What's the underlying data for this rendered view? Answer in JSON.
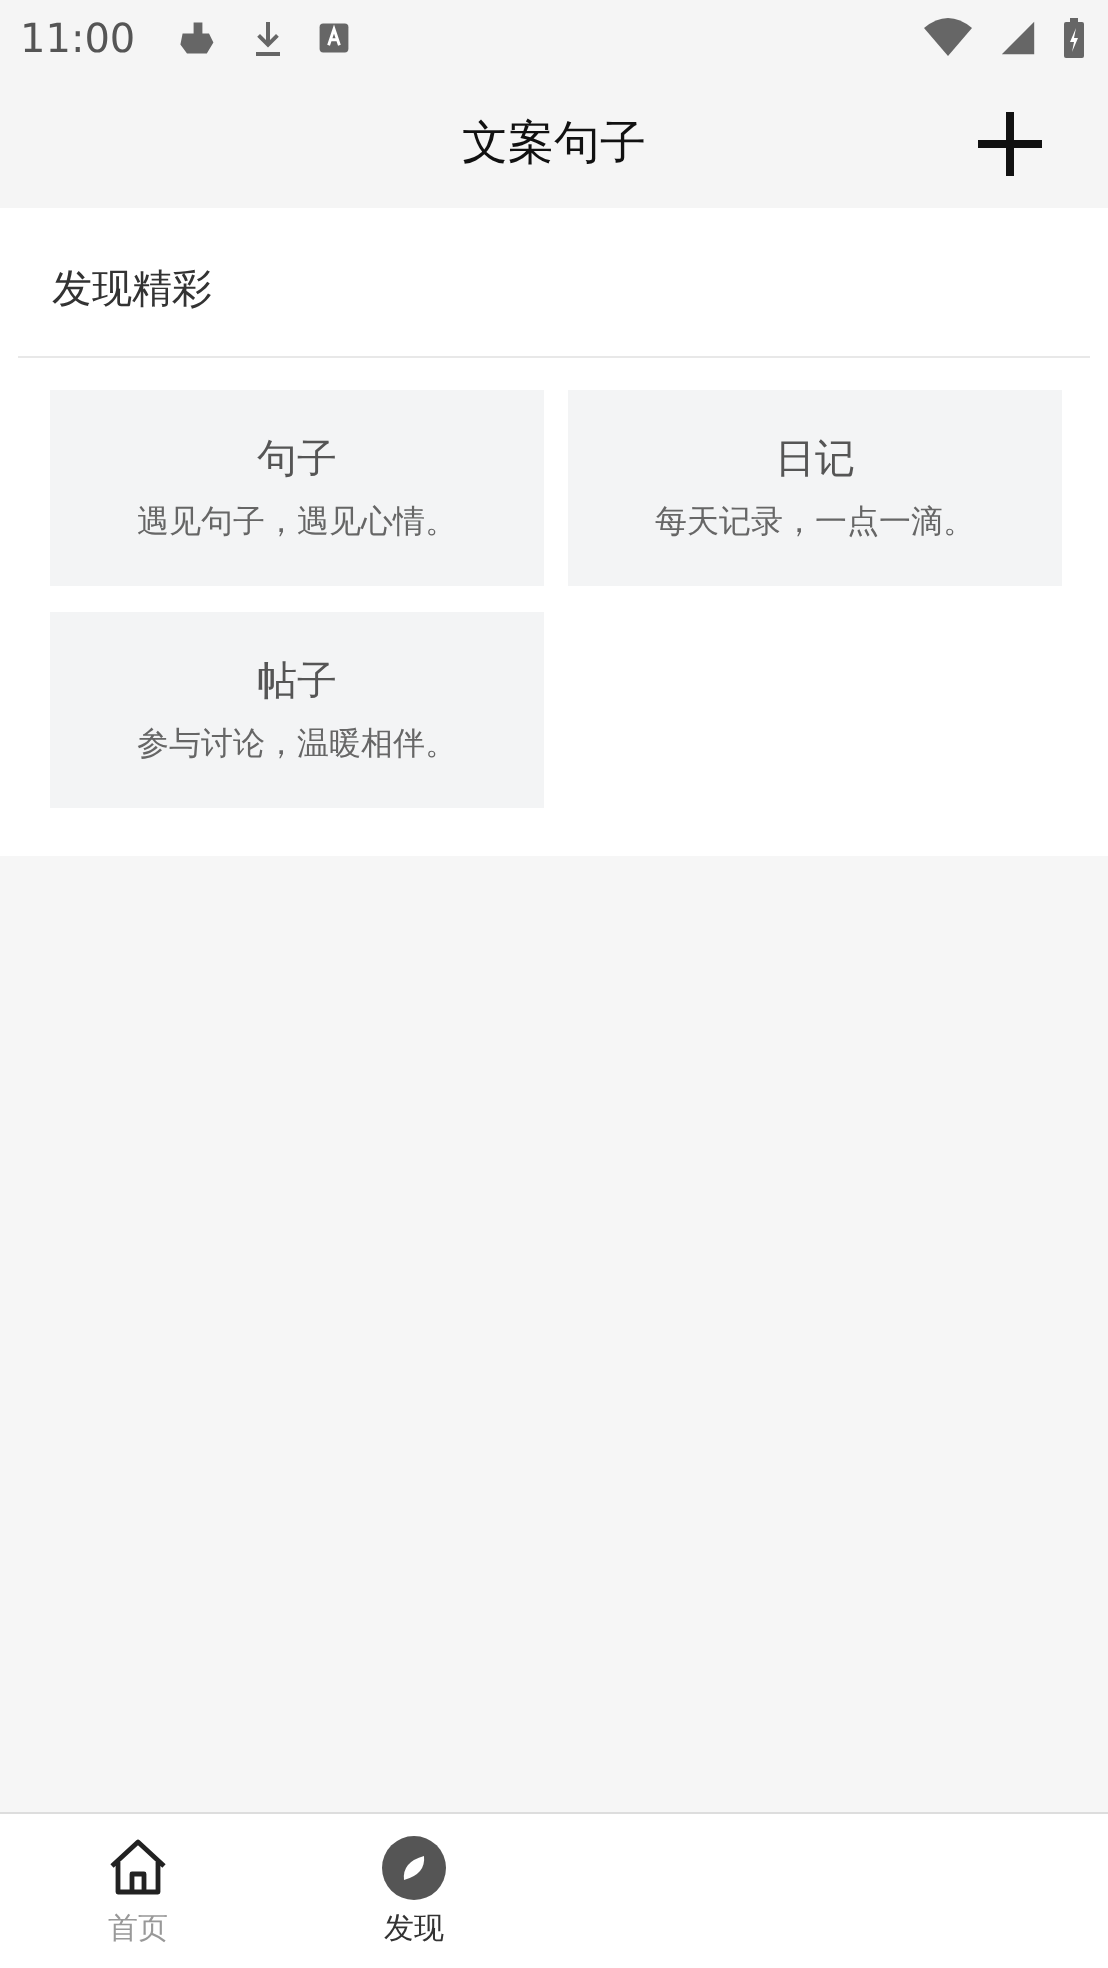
{
  "status_bar": {
    "time": "11:00"
  },
  "header": {
    "title": "文案句子"
  },
  "section": {
    "title": "发现精彩",
    "cards": [
      {
        "title": "句子",
        "subtitle": "遇见句子，遇见心情。"
      },
      {
        "title": "日记",
        "subtitle": "每天记录，一点一滴。"
      },
      {
        "title": "帖子",
        "subtitle": "参与讨论，温暖相伴。"
      }
    ]
  },
  "tab_bar": [
    {
      "kind": "home",
      "label": "首页",
      "selected": false
    },
    {
      "kind": "discover",
      "label": "发现",
      "selected": true
    }
  ]
}
